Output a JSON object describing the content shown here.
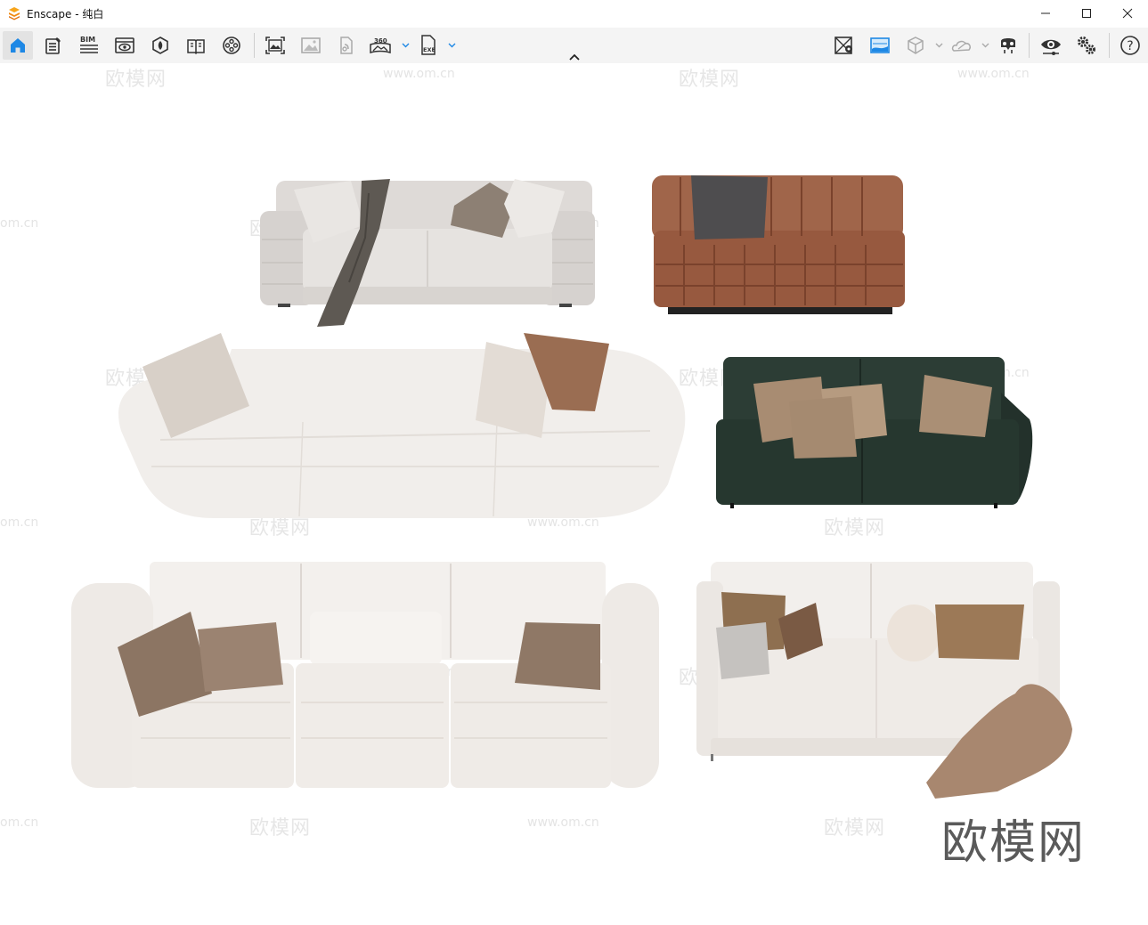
{
  "window": {
    "app_name": "Enscape",
    "title": "Enscape - 纯白",
    "controls": [
      "minimize",
      "maximize",
      "close"
    ]
  },
  "toolbar": {
    "left_icons": [
      "home-icon",
      "document-edit-icon",
      "bim-icon",
      "view-eye-icon",
      "asset-library-icon",
      "book-icon",
      "video-reel-icon",
      "screenshot-icon",
      "image-icon",
      "export-file-icon",
      "panorama-360-icon",
      "exe-export-icon"
    ],
    "bim_label": "BIM",
    "pano_label": "360",
    "exe_label": "EXE",
    "right_icons": [
      "map-pin-icon",
      "sky-image-icon",
      "cube-view-icon",
      "cloud-icon",
      "vr-headset-icon",
      "visual-settings-eye-icon",
      "settings-gears-icon",
      "help-icon"
    ],
    "help_label": "?",
    "accent_color": "#1e88e5"
  },
  "viewport": {
    "watermark_cn": "欧模网",
    "watermark_url": "www.om.cn",
    "watermark_url_edge": "om.cn",
    "brand_watermark": "欧模网"
  },
  "scene": {
    "sofas": [
      {
        "name": "light-grey-sofa-with-throw",
        "color": "#d9d5d2"
      },
      {
        "name": "brown-leather-tufted-sofa",
        "color": "#9b5e43"
      },
      {
        "name": "white-curved-sofa",
        "color": "#f1eeeb"
      },
      {
        "name": "dark-green-sofa",
        "color": "#26372f"
      },
      {
        "name": "white-modular-sofa",
        "color": "#eeeae6"
      },
      {
        "name": "white-sofa-with-plaid-throw",
        "color": "#ece8e4"
      }
    ]
  }
}
